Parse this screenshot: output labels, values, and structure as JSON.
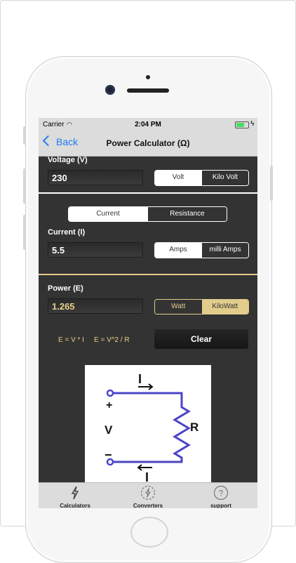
{
  "status": {
    "carrier": "Carrier",
    "time": "2:04 PM"
  },
  "nav": {
    "back_label": "Back",
    "title": "Power Calculator (Ω)"
  },
  "voltage": {
    "label": "Voltage (V)",
    "value": "230",
    "units": [
      "Volt",
      "Kilo Volt"
    ],
    "selected_unit": "Volt"
  },
  "mode": {
    "options": [
      "Current",
      "Resistance"
    ],
    "selected": "Current"
  },
  "current": {
    "label": "Current (I)",
    "value": "5.5",
    "units": [
      "Amps",
      "milli Amps"
    ],
    "selected_unit": "Amps"
  },
  "power": {
    "label": "Power (E)",
    "value": "1.265",
    "units": [
      "Watt",
      "KiloWatt"
    ],
    "selected_unit": "KiloWatt"
  },
  "formulas": {
    "f1": "E = V * I",
    "f2": "E = V^2 / R"
  },
  "clear_label": "Clear",
  "diagram": {
    "top_label": "I",
    "bottom_label": "I",
    "plus": "+",
    "minus": "−",
    "v_label": "V",
    "r_label": "R"
  },
  "tabs": [
    {
      "label": "Calculators",
      "icon": "lightning-icon"
    },
    {
      "label": "Converters",
      "icon": "lightning-circle-icon"
    },
    {
      "label": "support",
      "icon": "question-circle-icon"
    }
  ],
  "colors": {
    "accent_gold": "#e2cc8c",
    "ios_blue": "#1e7cf6",
    "panel": "#333333"
  }
}
